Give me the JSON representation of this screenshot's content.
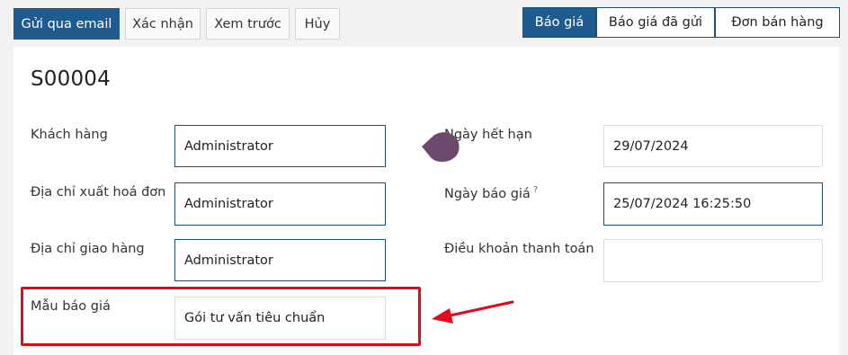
{
  "toolbar": {
    "send_email": "Gửi qua email",
    "confirm": "Xác nhận",
    "preview": "Xem trước",
    "cancel": "Hủy"
  },
  "statusbar": {
    "items": [
      "Báo giá",
      "Báo giá đã gửi",
      "Đơn bán hàng"
    ],
    "active": "Báo giá"
  },
  "record": {
    "name": "S00004"
  },
  "form": {
    "customer_label": "Khách hàng",
    "customer_value": "Administrator",
    "invoice_address_label": "Địa chỉ xuất hoá đơn",
    "invoice_address_value": "Administrator",
    "delivery_address_label": "Địa chỉ giao hàng",
    "delivery_address_value": "Administrator",
    "quote_template_label": "Mẫu báo giá",
    "quote_template_value": "Gói tư vấn tiêu chuẩn",
    "expiration_label": "Ngày hết hạn",
    "expiration_value": "29/07/2024",
    "quotation_date_label": "Ngày báo giá",
    "quotation_date_help": "?",
    "quotation_date_value": "25/07/2024 16:25:50",
    "payment_terms_label": "Điều khoản thanh toán",
    "payment_terms_value": ""
  },
  "colors": {
    "primary": "#1f5b8f",
    "highlight": "#e10a1a",
    "cursor": "#6b4a6e"
  },
  "icons": {
    "cursor": "mouse-cursor-icon",
    "arrow": "red-arrow-icon"
  }
}
